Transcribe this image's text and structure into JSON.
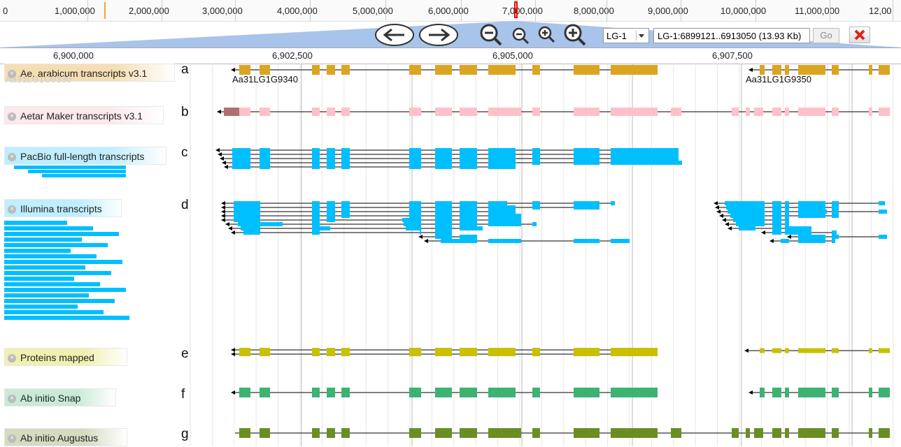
{
  "overview": {
    "labels": [
      "0",
      "1,000,000",
      "2,000,000",
      "3,000,000",
      "4,000,000",
      "5,000,000",
      "6,000,000",
      "7,000,000",
      "8,000,000",
      "9,000,000",
      "10,000,000",
      "11,000,000",
      "12,00"
    ]
  },
  "nav": {
    "ref_seq": "LG-1",
    "location": "LG-1:6899121..6913050 (13.93 Kb)",
    "go_label": "Go",
    "icons": [
      "arrow-left-icon",
      "arrow-right-icon",
      "zoom-out-large-icon",
      "zoom-out-icon",
      "zoom-in-icon",
      "zoom-in-large-icon",
      "clear-highlight-icon"
    ]
  },
  "ruler": {
    "labels": [
      "6,900,000",
      "6,902,500",
      "6,905,000",
      "6,907,500"
    ]
  },
  "tracks": [
    {
      "id": "a",
      "letter": "a",
      "label": "Ae. arabicum transcripts v3.1",
      "color": "#daa520",
      "label_bg": "#f5deb3"
    },
    {
      "id": "b",
      "letter": "b",
      "label": "Aetar Maker transcripts v3.1",
      "color": "#ffc0cb",
      "label_bg": "#fde8ec"
    },
    {
      "id": "c",
      "letter": "c",
      "label": "PacBio full-length transcripts",
      "color": "#00bfff",
      "label_bg": "#bfeeff"
    },
    {
      "id": "d",
      "letter": "d",
      "label": "Illumina transcripts",
      "color": "#00bfff",
      "label_bg": "#bfeeff"
    },
    {
      "id": "e",
      "letter": "e",
      "label": "Proteins mapped",
      "color": "#c8c000",
      "label_bg": "#f0f0b0"
    },
    {
      "id": "f",
      "letter": "f",
      "label": "Ab initio Snap",
      "color": "#3cb371",
      "label_bg": "#c8ead6"
    },
    {
      "id": "g",
      "letter": "g",
      "label": "Ab initio Augustus",
      "color": "#6b8e23",
      "label_bg": "#d3dcc0"
    }
  ],
  "genes": {
    "left": "Aa31LG1G9340",
    "right": "Aa31LG1G9350",
    "ghost": "Aa31LG1G9330"
  },
  "colors": {
    "accent": "#4a90d9",
    "zoom_band": "#a9c4ea",
    "utr": "#b07070"
  }
}
